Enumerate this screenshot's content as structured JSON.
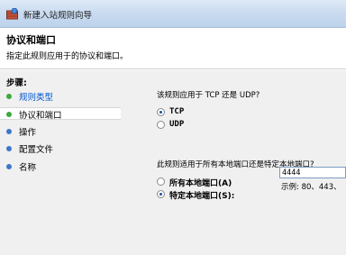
{
  "window": {
    "title": "新建入站规则向导"
  },
  "header": {
    "title": "协议和端口",
    "subtitle": "指定此规则应用于的协议和端口。"
  },
  "steps": {
    "label": "步骤:",
    "items": [
      {
        "label": "规则类型",
        "state": "link"
      },
      {
        "label": "协议和端口",
        "state": "current"
      },
      {
        "label": "操作",
        "state": "normal"
      },
      {
        "label": "配置文件",
        "state": "normal"
      },
      {
        "label": "名称",
        "state": "normal"
      }
    ]
  },
  "protocol": {
    "question": "该规则应用于 TCP 还是 UDP?",
    "options": [
      {
        "label": "TCP",
        "checked": true
      },
      {
        "label": "UDP",
        "checked": false
      }
    ]
  },
  "ports": {
    "question": "此规则适用于所有本地端口还是特定本地端口?",
    "options": [
      {
        "label": "所有本地端口(A)",
        "checked": false
      },
      {
        "label": "特定本地端口(S):",
        "checked": true
      }
    ],
    "value": "4444",
    "example": "示例: 80、443、"
  },
  "colors": {
    "link": "#0055cc",
    "step_dot_green": "#3caa3c",
    "step_dot_blue": "#3c78c8"
  }
}
